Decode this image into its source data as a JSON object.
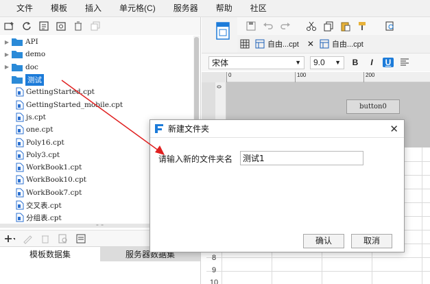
{
  "menu": [
    "文件",
    "模板",
    "插入",
    "单元格(C)",
    "服务器",
    "帮助",
    "社区"
  ],
  "tree": {
    "items": [
      {
        "type": "folder",
        "label": "API",
        "expandable": true
      },
      {
        "type": "folder",
        "label": "demo",
        "expandable": true
      },
      {
        "type": "folder",
        "label": "doc",
        "expandable": true
      },
      {
        "type": "folder",
        "label": "测试",
        "selected": true
      },
      {
        "type": "file",
        "label": "GettingStarted.cpt"
      },
      {
        "type": "file",
        "label": "GettingStarted_mobile.cpt"
      },
      {
        "type": "file",
        "label": "js.cpt"
      },
      {
        "type": "file",
        "label": "one.cpt"
      },
      {
        "type": "file",
        "label": "Poly16.cpt"
      },
      {
        "type": "file",
        "label": "Poly3.cpt"
      },
      {
        "type": "file",
        "label": "WorkBook1.cpt"
      },
      {
        "type": "file",
        "label": "WorkBook10.cpt"
      },
      {
        "type": "file",
        "label": "WorkBook7.cpt"
      },
      {
        "type": "file",
        "label": "交叉表.cpt"
      },
      {
        "type": "file",
        "label": "分组表.cpt"
      }
    ]
  },
  "left_tabs": [
    "模板数据集",
    "服务器数据集"
  ],
  "editor_tabs": [
    {
      "label": "自由...cpt"
    },
    {
      "label": "自由...cpt"
    }
  ],
  "format": {
    "font": "宋体",
    "size": "9.0",
    "bold": "B",
    "italic": "I",
    "underline": "U"
  },
  "ruler": {
    "ticks": [
      "0",
      "100",
      "200"
    ]
  },
  "canvas": {
    "button_label": "button0"
  },
  "grid": {
    "row_numbers": [
      "8",
      "9",
      "10"
    ]
  },
  "dialog": {
    "title": "新建文件夹",
    "label": "请输入新的文件夹名",
    "input_value": "测试1",
    "ok": "确认",
    "cancel": "取消"
  },
  "colors": {
    "accent": "#1c7bd9",
    "annotation": "#e02020"
  }
}
